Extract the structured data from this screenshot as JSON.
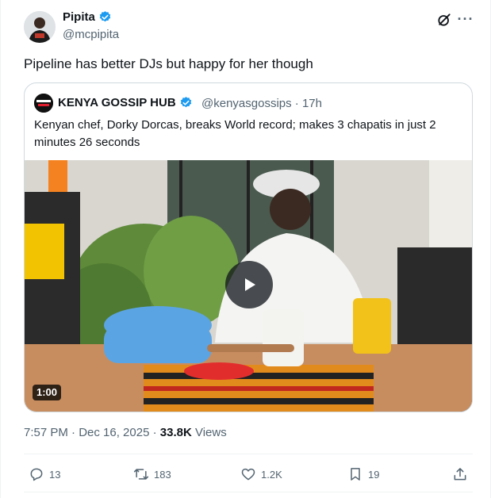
{
  "author": {
    "name": "Pipita",
    "handle": "@mcpipita"
  },
  "tweet": {
    "text": "Pipeline has better DJs but happy for her though"
  },
  "quote": {
    "name": "KENYA GOSSIP HUB",
    "handle_time": "@kenyasgossips · 17h",
    "text": "Kenyan chef, Dorky Dorcas, breaks World record; makes 3 chapatis in just 2 minutes 26 seconds",
    "video_duration": "1:00"
  },
  "meta": {
    "timestamp": "7:57 PM · Dec 16, 2025 · ",
    "views_count": "33.8K",
    "views_label": " Views"
  },
  "actions": {
    "replies": "13",
    "reposts": "183",
    "likes": "1.2K",
    "bookmarks": "19"
  },
  "colors": {
    "verified": "#1d9bf0",
    "secondary_text": "#536471",
    "border": "#cfd9de"
  }
}
